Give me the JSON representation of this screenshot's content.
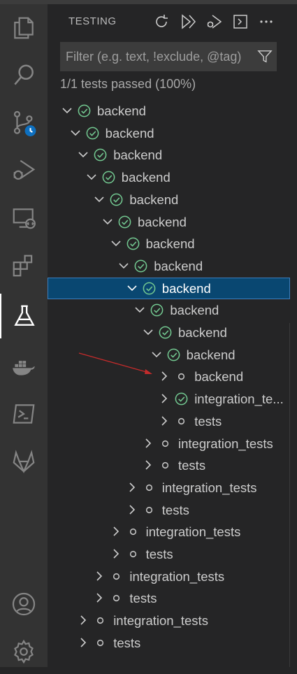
{
  "sidebar": {
    "title": "TESTING",
    "toolbar": [
      {
        "name": "refresh-tests-button",
        "icon": "refresh-icon"
      },
      {
        "name": "run-all-tests-button",
        "icon": "run-icon"
      },
      {
        "name": "debug-all-tests-button",
        "icon": "debug-icon"
      },
      {
        "name": "show-output-button",
        "icon": "terminal-icon"
      },
      {
        "name": "more-actions-button",
        "icon": "ellipsis-icon"
      }
    ],
    "filter_placeholder": "Filter (e.g. text, !exclude, @tag)",
    "summary": "1/1 tests passed (100%)"
  },
  "activity_bar": [
    "explorer-icon",
    "search-icon",
    "source-control-icon",
    "run-debug-icon",
    "remote-explorer-icon",
    "extensions-icon",
    "testing-icon",
    "docker-icon",
    "terminal-icon",
    "gitlab-icon",
    "accounts-icon",
    "settings-gear-icon"
  ],
  "tree": [
    {
      "label": "backend",
      "depth": 0,
      "expanded": true,
      "status": "passed"
    },
    {
      "label": "backend",
      "depth": 1,
      "expanded": true,
      "status": "passed"
    },
    {
      "label": "backend",
      "depth": 2,
      "expanded": true,
      "status": "passed"
    },
    {
      "label": "backend",
      "depth": 3,
      "expanded": true,
      "status": "passed"
    },
    {
      "label": "backend",
      "depth": 4,
      "expanded": true,
      "status": "passed"
    },
    {
      "label": "backend",
      "depth": 5,
      "expanded": true,
      "status": "passed"
    },
    {
      "label": "backend",
      "depth": 6,
      "expanded": true,
      "status": "passed"
    },
    {
      "label": "backend",
      "depth": 7,
      "expanded": true,
      "status": "passed"
    },
    {
      "label": "backend",
      "depth": 8,
      "expanded": true,
      "status": "passed",
      "selected": true
    },
    {
      "label": "backend",
      "depth": 9,
      "expanded": true,
      "status": "passed"
    },
    {
      "label": "backend",
      "depth": 10,
      "expanded": true,
      "status": "passed"
    },
    {
      "label": "backend",
      "depth": 11,
      "expanded": true,
      "status": "passed"
    },
    {
      "label": "backend",
      "depth": 12,
      "expanded": false,
      "status": "unset"
    },
    {
      "label": "integration_te...",
      "depth": 12,
      "expanded": false,
      "status": "passed"
    },
    {
      "label": "tests",
      "depth": 12,
      "expanded": false,
      "status": "unset"
    },
    {
      "label": "integration_tests",
      "depth": 10,
      "expanded": false,
      "status": "unset"
    },
    {
      "label": "tests",
      "depth": 10,
      "expanded": false,
      "status": "unset"
    },
    {
      "label": "integration_tests",
      "depth": 8,
      "expanded": false,
      "status": "unset"
    },
    {
      "label": "tests",
      "depth": 8,
      "expanded": false,
      "status": "unset"
    },
    {
      "label": "integration_tests",
      "depth": 6,
      "expanded": false,
      "status": "unset"
    },
    {
      "label": "tests",
      "depth": 6,
      "expanded": false,
      "status": "unset"
    },
    {
      "label": "integration_tests",
      "depth": 4,
      "expanded": false,
      "status": "unset"
    },
    {
      "label": "tests",
      "depth": 4,
      "expanded": false,
      "status": "unset"
    },
    {
      "label": "integration_tests",
      "depth": 2,
      "expanded": false,
      "status": "unset"
    },
    {
      "label": "tests",
      "depth": 2,
      "expanded": false,
      "status": "unset"
    }
  ],
  "colors": {
    "passed": "#73c991",
    "unset": "#c5c5c5",
    "selection": "#094771",
    "annotation_arrow": "#c42b2b"
  }
}
